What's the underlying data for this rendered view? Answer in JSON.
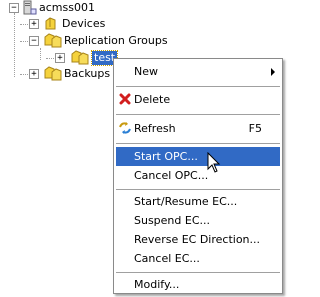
{
  "tree": {
    "root": {
      "label": "acmss001",
      "expander": "−"
    },
    "devices": {
      "label": "Devices",
      "expander": "+"
    },
    "replication_groups": {
      "label": "Replication Groups",
      "expander": "−"
    },
    "test": {
      "label": "test",
      "expander": "+",
      "selected": true
    },
    "backups": {
      "label": "Backups",
      "expander": "+"
    }
  },
  "context_menu": {
    "new": {
      "label": "New",
      "has_submenu": true
    },
    "delete": {
      "label": "Delete",
      "icon": "red-x-icon"
    },
    "refresh": {
      "label": "Refresh",
      "shortcut": "F5",
      "icon": "refresh-icon"
    },
    "start_opc": {
      "label": "Start OPC...",
      "highlighted": true
    },
    "cancel_opc": {
      "label": "Cancel OPC..."
    },
    "start_resume_ec": {
      "label": "Start/Resume EC..."
    },
    "suspend_ec": {
      "label": "Suspend EC..."
    },
    "reverse_ec": {
      "label": "Reverse EC Direction..."
    },
    "cancel_ec": {
      "label": "Cancel EC..."
    },
    "modify": {
      "label": "Modify..."
    }
  },
  "colors": {
    "selection": "#316ac5",
    "folder_yellow": "#f5d23c",
    "delete_red": "#d21e1e"
  }
}
